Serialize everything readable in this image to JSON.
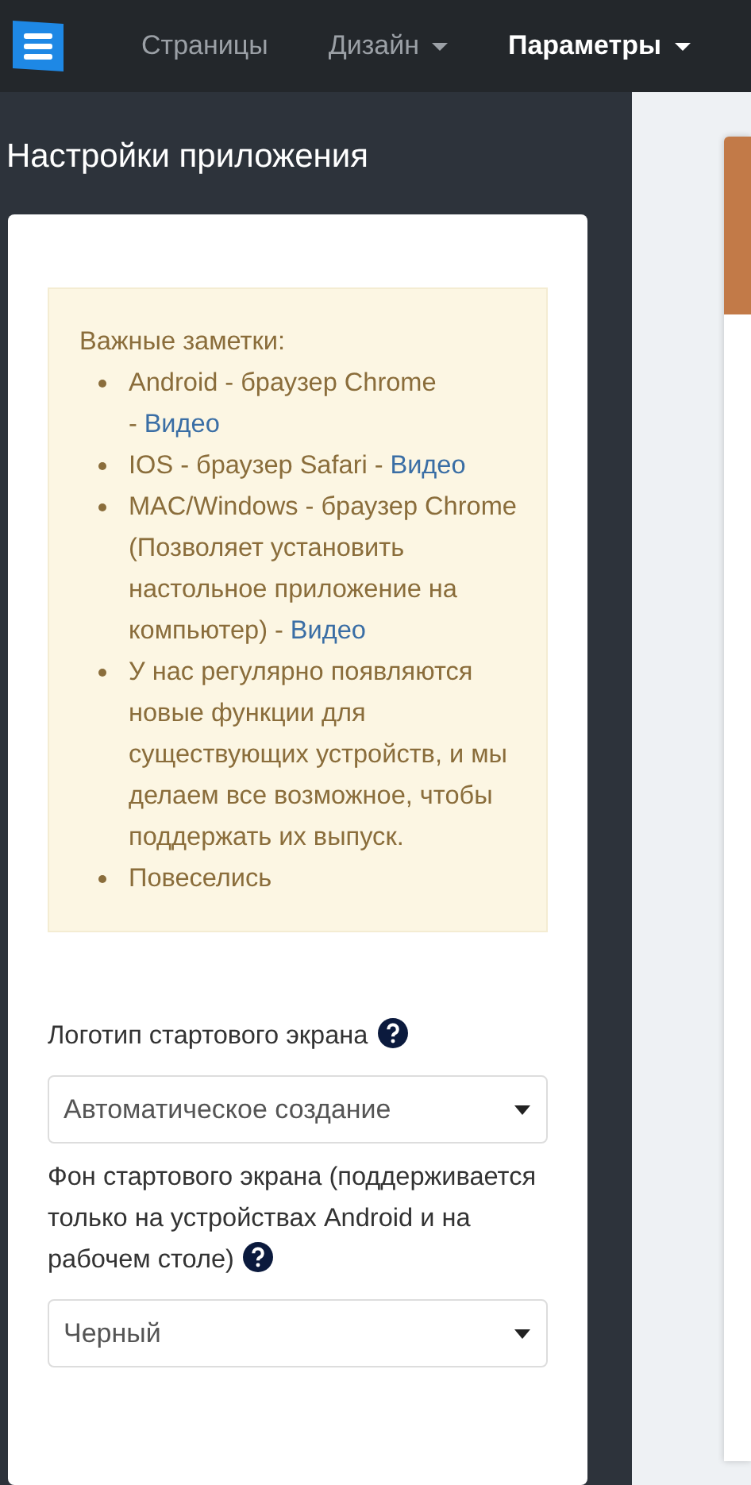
{
  "navbar": {
    "items": [
      {
        "label": "Страницы",
        "selected": false,
        "dropdown": false
      },
      {
        "label": "Дизайн",
        "selected": false,
        "dropdown": true
      },
      {
        "label": "Параметры",
        "selected": true,
        "dropdown": true
      }
    ]
  },
  "page_title": "Настройки приложения",
  "notes": {
    "heading": "Важные заметки:",
    "items": [
      {
        "text": "Android - браузер Chrome -",
        "link": "Видео"
      },
      {
        "text": "IOS - браузер Safari -",
        "link": "Видео"
      },
      {
        "text": "MAC/Windows - браузер Chrome (Позволяет установить настольное приложение на компьютер) -",
        "link": "Видео"
      },
      {
        "text": "У нас регулярно появляются новые функции для существующих устройств, и мы делаем все возможное, чтобы поддержать их выпуск."
      },
      {
        "text": "Повеселись"
      }
    ]
  },
  "fields": [
    {
      "label": "Логотип стартового экрана",
      "value": "Автоматическое создание"
    },
    {
      "label": "Фон стартового экрана (поддерживается только на устройствах Android и на рабочем столе)",
      "value": "Черный"
    }
  ]
}
